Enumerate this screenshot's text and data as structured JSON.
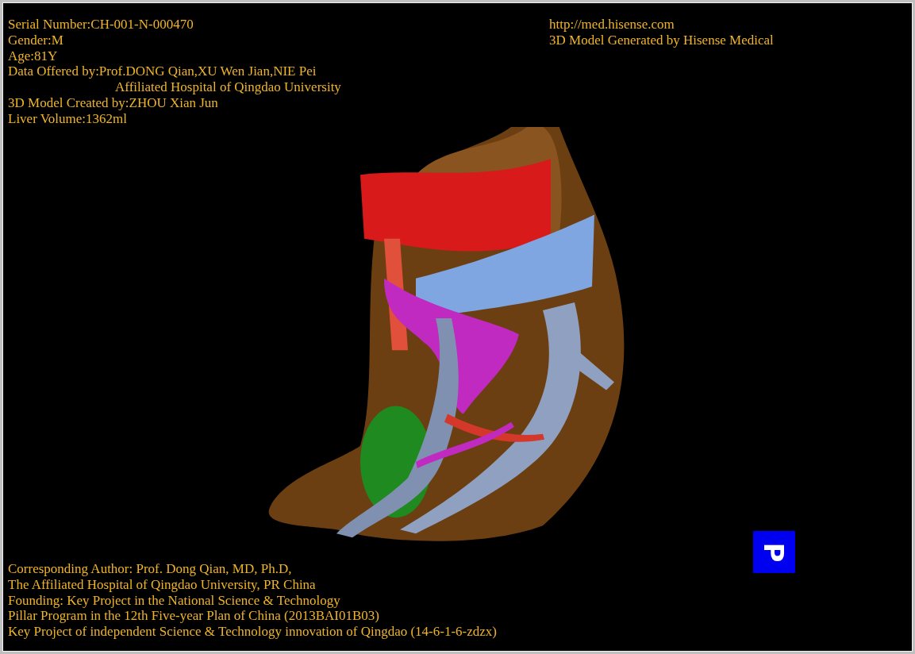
{
  "header": {
    "left_lines": [
      {
        "kind": "field",
        "text": "Serial Number:CH-001-N-000470"
      },
      {
        "kind": "field",
        "text": "Gender:M"
      },
      {
        "kind": "field",
        "text": "Age:81Y"
      },
      {
        "kind": "field",
        "text": "Data Offered by:Prof.DONG Qian,XU Wen Jian,NIE Pei"
      },
      {
        "kind": "continuation",
        "text": "Affiliated Hospital of Qingdao University"
      },
      {
        "kind": "field",
        "text": "3D Model Created by:ZHOU Xian Jun"
      },
      {
        "kind": "field",
        "text": "Liver Volume:1362ml"
      }
    ],
    "right_lines": [
      "http://med.hisense.com",
      "3D Model Generated by Hisense Medical"
    ]
  },
  "orientation_marker": {
    "label": "P"
  },
  "footer_lines": [
    "Corresponding Author: Prof. Dong Qian, MD, Ph.D,",
    "The Affiliated Hospital of Qingdao University, PR China",
    "Founding: Key Project in the National Science & Technology",
    "Pillar Program in the 12th Five-year Plan of China (2013BAI01B03)",
    "Key Project of independent Science & Technology innovation of Qingdao (14-6-1-6-zdzx)"
  ]
}
